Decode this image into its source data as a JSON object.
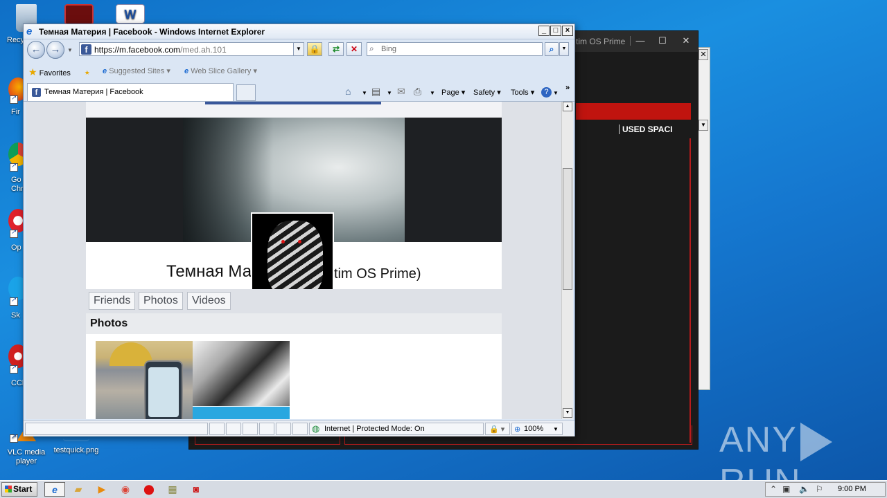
{
  "desktop": {
    "icons": [
      {
        "label": "Recy"
      },
      {
        "label": "Fir"
      },
      {
        "label": "Go\nChr"
      },
      {
        "label": "Op"
      },
      {
        "label": "Sk"
      },
      {
        "label": "CCl"
      },
      {
        "label": "VLC media player"
      },
      {
        "label": "testquick.png"
      }
    ],
    "watermark": "ANY RUN"
  },
  "dark_window": {
    "title_fragment": "tim OS Prime",
    "minimize": "—",
    "maximize": "☐",
    "close": "✕",
    "column_header": "USED SPACI",
    "accent_color": "#c0140f"
  },
  "ie": {
    "title": "Темная Материя | Facebook - Windows Internet Explorer",
    "window_buttons": {
      "minimize": "_",
      "maximize": "□",
      "close": "×"
    },
    "address": {
      "host": "https://m.facebook.com",
      "path": "/med.ah.101"
    },
    "search_placeholder": "Bing",
    "favorites": {
      "favorites_label": "Favorites",
      "suggested_sites": "Suggested Sites",
      "web_slice_gallery": "Web Slice Gallery"
    },
    "tab": {
      "label": "Темная Материя | Facebook"
    },
    "commands": {
      "page": "Page",
      "safety": "Safety",
      "tools": "Tools",
      "more": "»"
    },
    "status": {
      "zone": "Internet | Protected Mode: On",
      "zoom": "100%"
    }
  },
  "facebook": {
    "profile_name_part1": "Темная Ма",
    "profile_name_part2": "tim OS Prime)",
    "tabs": [
      {
        "label": "Friends"
      },
      {
        "label": "Photos"
      },
      {
        "label": "Videos"
      }
    ],
    "photos_heading": "Photos",
    "brand_color": "#3b5998"
  },
  "taskbar": {
    "start_label": "Start",
    "clock": "9:00 PM"
  }
}
